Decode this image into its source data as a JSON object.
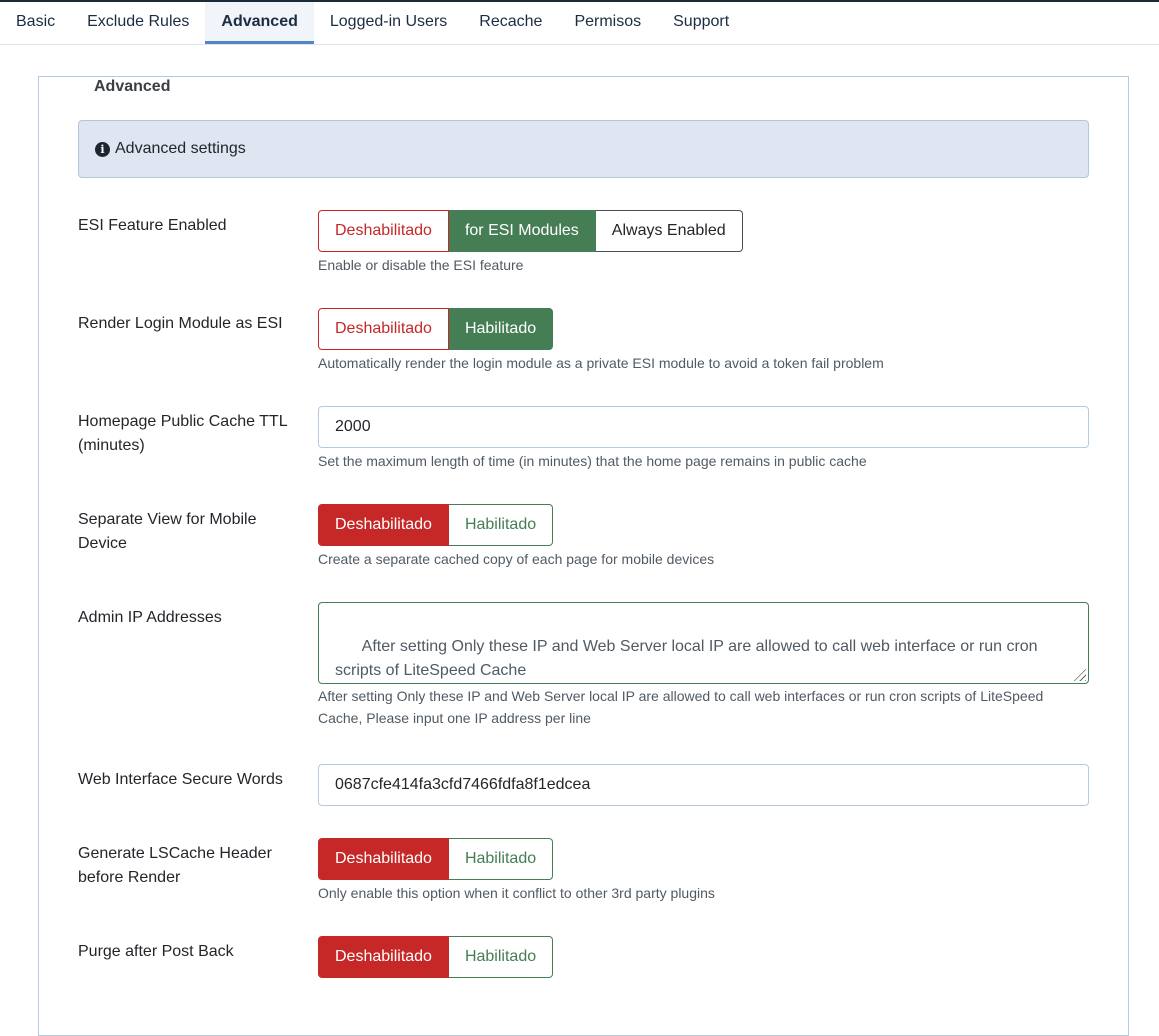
{
  "tabs": [
    {
      "label": "Basic",
      "active": false
    },
    {
      "label": "Exclude Rules",
      "active": false
    },
    {
      "label": "Advanced",
      "active": true
    },
    {
      "label": "Logged-in Users",
      "active": false
    },
    {
      "label": "Recache",
      "active": false
    },
    {
      "label": "Permisos",
      "active": false
    },
    {
      "label": "Support",
      "active": false
    }
  ],
  "panel": {
    "legend": "Advanced",
    "alert": {
      "icon": "info-circle-icon",
      "text": "Advanced settings"
    }
  },
  "fields": {
    "esi": {
      "label": "ESI Feature Enabled",
      "options": [
        "Deshabilitado",
        "for ESI Modules",
        "Always Enabled"
      ],
      "selected": "for ESI Modules",
      "hint": "Enable or disable the ESI feature"
    },
    "login_esi": {
      "label": "Render Login Module as ESI",
      "options": [
        "Deshabilitado",
        "Habilitado"
      ],
      "selected": "Habilitado",
      "hint": "Automatically render the login module as a private ESI module to avoid a token fail problem"
    },
    "home_ttl": {
      "label": "Homepage Public Cache TTL (minutes)",
      "value": "2000",
      "hint": "Set the maximum length of time (in minutes) that the home page remains in public cache"
    },
    "mobile_view": {
      "label": "Separate View for Mobile Device",
      "options": [
        "Deshabilitado",
        "Habilitado"
      ],
      "selected": "Deshabilitado",
      "hint": "Create a separate cached copy of each page for mobile devices"
    },
    "admin_ips": {
      "label": "Admin IP Addresses",
      "placeholder": "After setting Only these IP and Web Server local IP are allowed to call web interface or run cron scripts of LiteSpeed Cache\nPlease input one IP address per line",
      "hint": "After setting Only these IP and Web Server local IP are allowed to call web interfaces or run cron scripts of LiteSpeed Cache, Please input one IP address per line"
    },
    "secure_words": {
      "label": "Web Interface Secure Words",
      "value": "0687cfe414fa3cfd7466fdfa8f1edcea"
    },
    "lscache_header": {
      "label": "Generate LSCache Header before Render",
      "options": [
        "Deshabilitado",
        "Habilitado"
      ],
      "selected": "Deshabilitado",
      "hint": "Only enable this option when it conflict to other 3rd party plugins"
    },
    "purge_postback": {
      "label": "Purge after Post Back",
      "options": [
        "Deshabilitado",
        "Habilitado"
      ],
      "selected": "Deshabilitado"
    }
  },
  "colors": {
    "enabled_green": "#457d54",
    "disabled_red": "#c52827",
    "tab_accent": "#5384c3",
    "alert_bg": "#dfe5f1"
  }
}
